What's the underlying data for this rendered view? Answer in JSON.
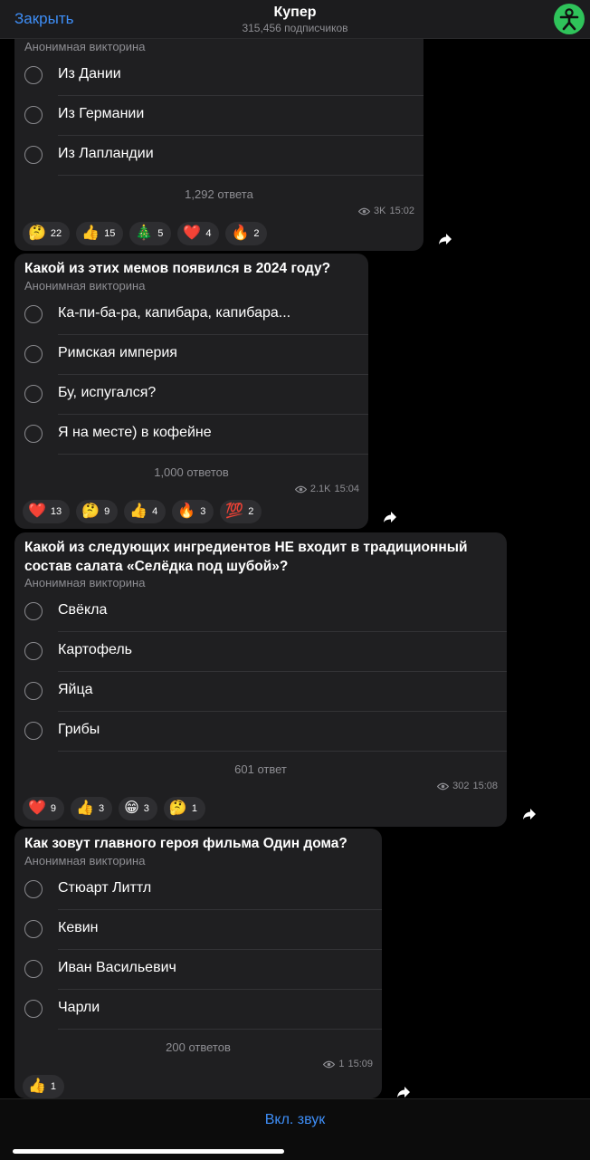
{
  "header": {
    "close_label": "Закрыть",
    "title": "Купер",
    "subscribers": "315,456 подписчиков",
    "accent": "#3e8ef7",
    "avatar_color": "#2fc35a",
    "avatar_icon": "person-icon"
  },
  "polls": [
    {
      "question": "",
      "type_label": "Анонимная викторина",
      "options": [
        "Из Дании",
        "Из Германии",
        "Из Лапландии"
      ],
      "votes": "1,292 ответа",
      "views": "3K",
      "time": "15:02",
      "reactions": [
        {
          "emoji": "🤔",
          "count": "22"
        },
        {
          "emoji": "👍",
          "count": "15"
        },
        {
          "emoji": "🎄",
          "count": "5"
        },
        {
          "emoji": "❤️",
          "count": "4"
        },
        {
          "emoji": "🔥",
          "count": "2"
        }
      ]
    },
    {
      "question": "Какой из этих мемов появился в 2024 году?",
      "type_label": "Анонимная викторина",
      "options": [
        "Ка-пи-ба-ра, капибара, капибара...",
        "Римская империя",
        "Бу, испугался?",
        "Я на месте) в кофейне"
      ],
      "votes": "1,000 ответов",
      "views": "2.1K",
      "time": "15:04",
      "reactions": [
        {
          "emoji": "❤️",
          "count": "13"
        },
        {
          "emoji": "🤔",
          "count": "9"
        },
        {
          "emoji": "👍",
          "count": "4"
        },
        {
          "emoji": "🔥",
          "count": "3"
        },
        {
          "emoji": "💯",
          "count": "2"
        }
      ]
    },
    {
      "question_line1": "Какой из следующих ингредиентов НЕ входит в традиционный",
      "question_line2": "состав салата «Селёдка под шубой»?",
      "type_label": "Анонимная викторина",
      "options": [
        "Свёкла",
        "Картофель",
        "Яйца",
        "Грибы"
      ],
      "votes": "601 ответ",
      "views": "302",
      "time": "15:08",
      "reactions": [
        {
          "emoji": "❤️",
          "count": "9"
        },
        {
          "emoji": "👍",
          "count": "3"
        },
        {
          "emoji": "😁",
          "count": "3"
        },
        {
          "emoji": "🤔",
          "count": "1"
        }
      ]
    },
    {
      "question": "Как зовут главного героя фильма Один дома?",
      "type_label": "Анонимная викторина",
      "options": [
        "Стюарт Литтл",
        "Кевин",
        "Иван Васильевич",
        "Чарли"
      ],
      "votes": "200 ответов",
      "views": "1",
      "time": "15:09",
      "reactions": [
        {
          "emoji": "👍",
          "count": "1"
        }
      ]
    }
  ],
  "footer": {
    "sound_label": "Вкл. звук"
  }
}
